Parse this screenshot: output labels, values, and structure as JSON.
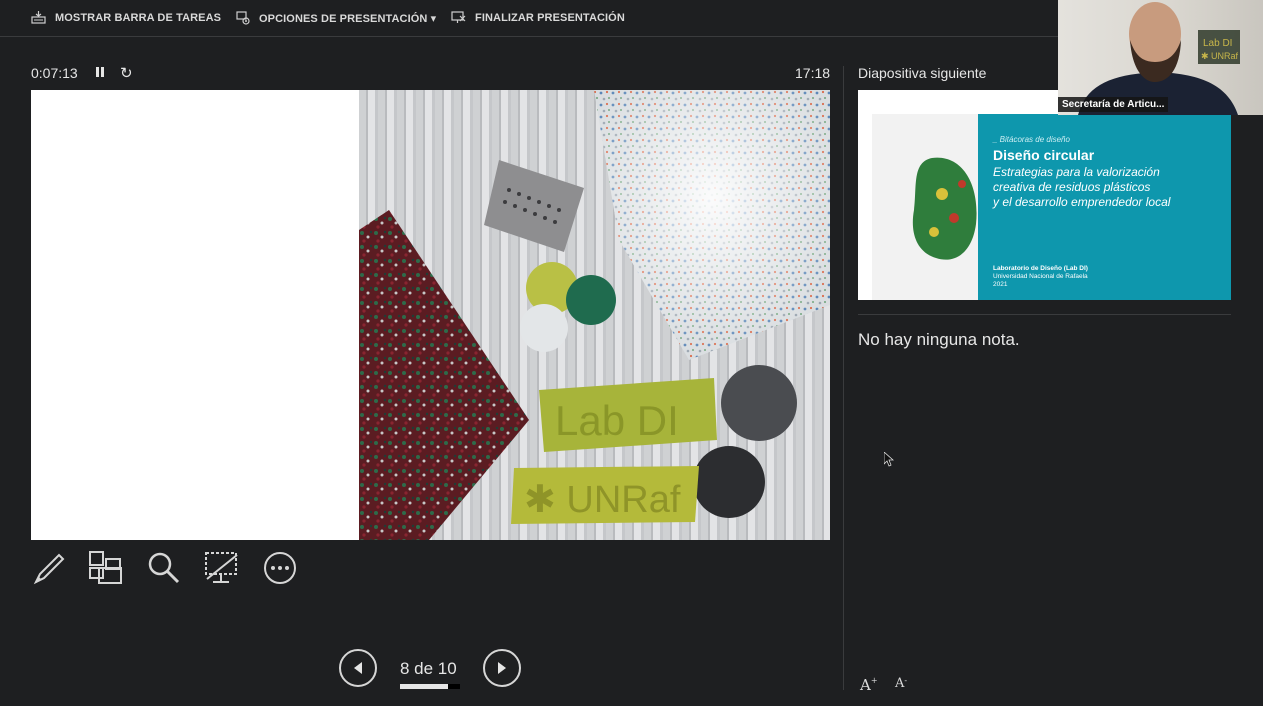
{
  "toolbar": {
    "taskbar_label": "MOSTRAR BARRA DE TAREAS",
    "options_label": "OPCIONES DE PRESENTACIÓN ▾",
    "end_label": "FINALIZAR PRESENTACIÓN"
  },
  "timer": {
    "elapsed": "0:07:13",
    "clock": "17:18"
  },
  "slide_photo": {
    "sign_top": "Lab DI",
    "sign_bottom": "✱ UNRaf"
  },
  "navigation": {
    "counter": "8 de 10",
    "progress_fraction": 0.8
  },
  "next_panel": {
    "label": "Diapositiva siguiente",
    "kicker": "_ Bitácoras de diseño",
    "title": "Diseño circular",
    "subtitle_line1": "Estrategias para la valorización",
    "subtitle_line2": "creativa de residuos plásticos",
    "subtitle_line3": "y el desarrollo emprendedor local",
    "org_line1": "Laboratorio de Diseño (Lab DI)",
    "org_line2": "Universidad Nacional de Rafaela",
    "org_line3": "2021"
  },
  "notes": {
    "text": "No hay ninguna nota."
  },
  "font_controls": {
    "increase": "A",
    "decrease": "A"
  },
  "video": {
    "participant_name": "Secretaría de Articu...",
    "backdrop_line1": "Lab DI",
    "backdrop_line2": "✱ UNRaf"
  },
  "icons": [
    "taskbar-icon",
    "options-icon",
    "end-presentation-icon",
    "pause-icon",
    "restart-icon",
    "pen-icon",
    "all-slides-icon",
    "zoom-icon",
    "black-screen-icon",
    "more-options-icon",
    "previous-icon",
    "next-icon",
    "mouse-cursor"
  ],
  "colors": {
    "background": "#1e1f21",
    "accent_teal": "#0e97ad",
    "text": "#e6e6e6"
  }
}
